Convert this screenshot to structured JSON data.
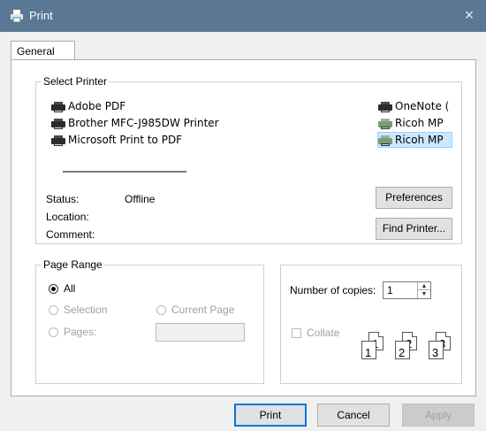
{
  "window": {
    "title": "Print",
    "close_icon": "×"
  },
  "tabs": [
    {
      "label": "General"
    }
  ],
  "select_printer": {
    "label": "Select Printer",
    "printers_left": [
      "Adobe PDF",
      "Brother MFC-J985DW Printer",
      "Microsoft Print to PDF"
    ],
    "printers_right": [
      "OneNote (",
      "Ricoh MP",
      "Ricoh MP"
    ],
    "selected": "Ricoh MP"
  },
  "status": {
    "status_label": "Status:",
    "status_value": "Offline",
    "location_label": "Location:",
    "location_value": "",
    "comment_label": "Comment:",
    "comment_value": ""
  },
  "buttons": {
    "preferences": "Preferences",
    "find_printer": "Find Printer...",
    "print": "Print",
    "cancel": "Cancel",
    "apply": "Apply"
  },
  "page_range": {
    "label": "Page Range",
    "all": "All",
    "selection": "Selection",
    "current_page": "Current Page",
    "pages": "Pages:",
    "pages_value": ""
  },
  "copies": {
    "label": "Number of copies:",
    "value": "1",
    "collate": "Collate",
    "collate_checked": false
  },
  "collate_pages": [
    "1",
    "1",
    "2",
    "2",
    "3",
    "3"
  ]
}
